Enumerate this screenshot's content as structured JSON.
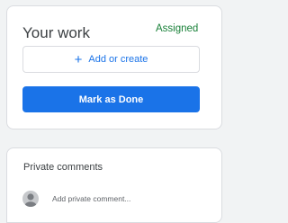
{
  "work": {
    "title": "Your work",
    "status": "Assigned",
    "add_label": "Add or create",
    "done_label": "Mark as Done"
  },
  "comments": {
    "title": "Private comments",
    "placeholder": "Add private comment..."
  },
  "colors": {
    "accent": "#1a73e8",
    "status_assigned": "#188038"
  },
  "icons": {
    "add": "plus-icon",
    "avatar": "person-avatar-icon"
  }
}
